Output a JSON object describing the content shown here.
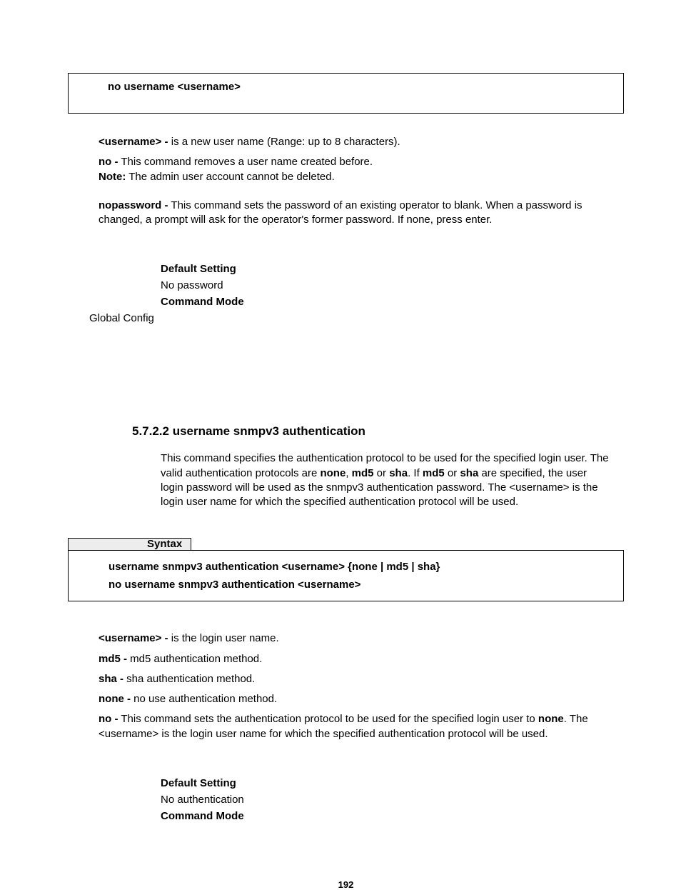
{
  "topSyntaxBox": {
    "line1": "no username <username>"
  },
  "params1": {
    "username_label": "<username> -",
    "username_text": " is a new user name (Range: up to 8 characters).",
    "no_label": "no -",
    "no_text": " This command removes a user name created before.",
    "note_label": "Note:",
    "note_text": " The admin user account cannot be deleted.",
    "nopassword_label": "nopassword -",
    "nopassword_text": " This command sets the password of an existing operator to blank. When a password is changed, a prompt will ask for the operator's former password. If none, press enter."
  },
  "settings1": {
    "default_heading": "Default Setting",
    "default_value": "No password",
    "mode_heading": "Command Mode",
    "mode_value": "Global Config"
  },
  "section": {
    "heading_num": "5.7.2.2 ",
    "heading_title": "username snmpv3 authentication",
    "body_pre": "This command specifies the authentication protocol to be used for the specified login user. The valid authentication protocols are ",
    "body_none": "none",
    "body_c1": ", ",
    "body_md5": "md5",
    "body_or1": " or ",
    "body_sha": "sha",
    "body_dot_if": ". If ",
    "body_md5_2": "md5",
    "body_or2": " or ",
    "body_sha_2": "sha",
    "body_post": " are specified, the user login password will be used as the snmpv3 authentication password. The <username> is the login user name for which the specified authentication protocol will be used."
  },
  "syntaxGroup": {
    "label": "Syntax",
    "line1": "username snmpv3 authentication <username> {none | md5 | sha}",
    "line2": "no username snmpv3 authentication <username>"
  },
  "params2": {
    "username_label": "<username> -",
    "username_text": " is the login user name.",
    "md5_label": "md5 -",
    "md5_text": " md5 authentication method.",
    "sha_label": "sha -",
    "sha_text": " sha authentication method.",
    "none_label": "none -",
    "none_text": " no use authentication method.",
    "no_label": "no -",
    "no_text_pre": " This command sets the authentication protocol to be used for the specified login user to ",
    "no_bold": "none",
    "no_text_post": ". The <username> is the login user name for which the specified authentication protocol will be used."
  },
  "settings2": {
    "default_heading": "Default Setting",
    "default_value": "No authentication",
    "mode_heading": "Command Mode"
  },
  "pageNumber": "192"
}
